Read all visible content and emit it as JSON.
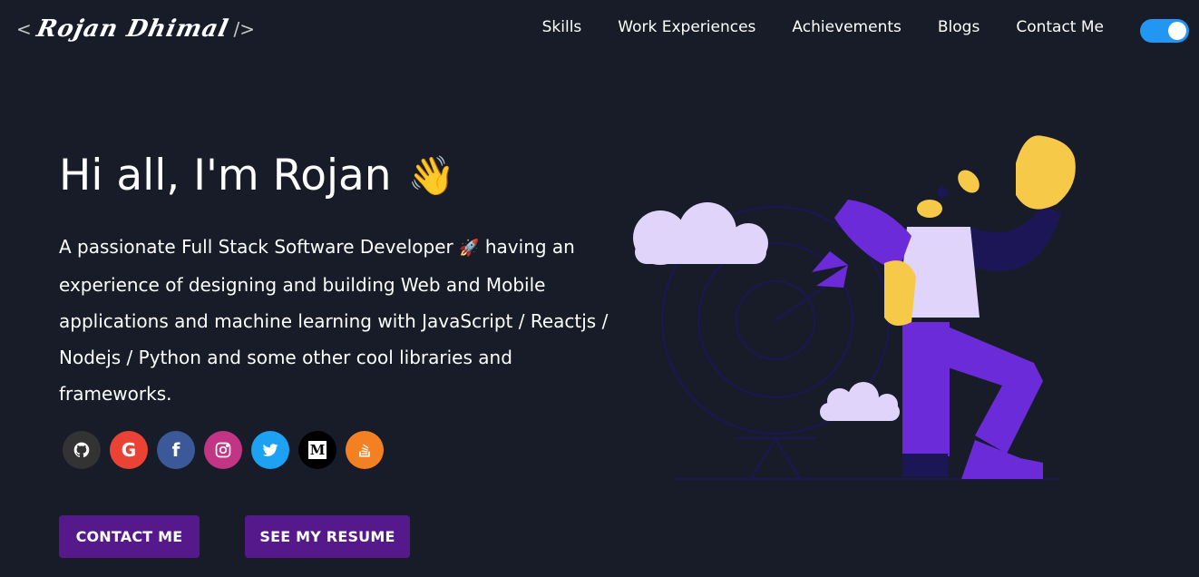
{
  "header": {
    "logo_open": "<",
    "logo_name": "Rojan Dhimal",
    "logo_close": "/>",
    "nav": [
      "Skills",
      "Work Experiences",
      "Achievements",
      "Blogs",
      "Contact Me"
    ],
    "theme_toggle": "on"
  },
  "hero": {
    "greeting": "Hi all, I'm Rojan",
    "wave_emoji": "👋",
    "desc_before": "A passionate Full Stack Software Developer",
    "rocket_emoji": "🚀",
    "desc_after": "having an experience of designing and building Web and Mobile applications and machine learning with JavaScript / Reactjs / Nodejs / Python and some other cool libraries and frameworks."
  },
  "social": [
    {
      "name": "github-icon",
      "color": "#333333"
    },
    {
      "name": "google-icon",
      "color": "#ea4335",
      "glyph": "G"
    },
    {
      "name": "facebook-icon",
      "color": "#3b5998",
      "glyph": "f"
    },
    {
      "name": "instagram-icon",
      "color": "#c13584"
    },
    {
      "name": "twitter-icon",
      "color": "#1da1f2"
    },
    {
      "name": "medium-icon",
      "color": "#000000",
      "glyph": "M"
    },
    {
      "name": "stackoverflow-icon",
      "color": "#f48024"
    }
  ],
  "buttons": {
    "contact": "CONTACT ME",
    "resume": "SEE MY RESUME"
  },
  "colors": {
    "background": "#171c28",
    "button": "#55198b",
    "toggle": "#2196f3",
    "illustration_purple": "#6c2bd9",
    "illustration_lavender": "#e0d4fb",
    "illustration_yellow": "#f7c948"
  }
}
